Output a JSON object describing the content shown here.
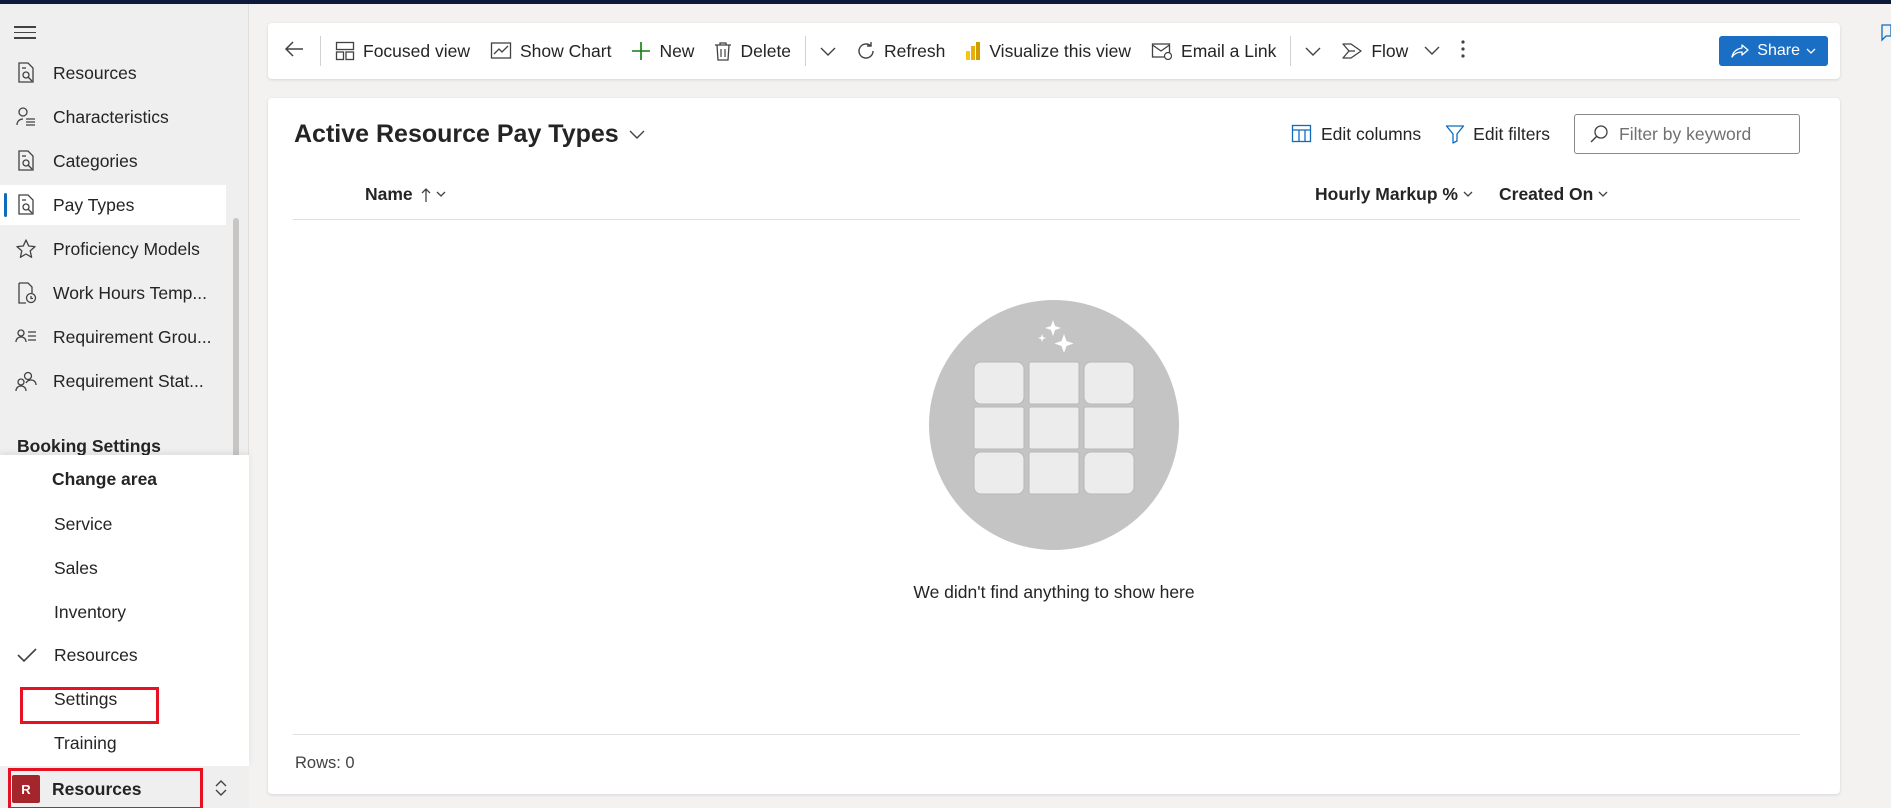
{
  "sidebar": {
    "items": [
      {
        "label": "Resources",
        "icon": "resource-list-icon",
        "active": false
      },
      {
        "label": "Characteristics",
        "icon": "person-characteristics-icon",
        "active": false
      },
      {
        "label": "Categories",
        "icon": "resource-list-icon",
        "active": false
      },
      {
        "label": "Pay Types",
        "icon": "resource-list-icon",
        "active": true
      },
      {
        "label": "Proficiency Models",
        "icon": "star-icon",
        "active": false
      },
      {
        "label": "Work Hours Temp...",
        "icon": "clock-document-icon",
        "active": false
      },
      {
        "label": "Requirement Grou...",
        "icon": "person-list-icon",
        "active": false
      },
      {
        "label": "Requirement Stat...",
        "icon": "people-icon",
        "active": false
      }
    ],
    "section_header": "Booking Settings",
    "area_menu": {
      "title": "Change area",
      "items": [
        {
          "label": "Service",
          "checked": false
        },
        {
          "label": "Sales",
          "checked": false
        },
        {
          "label": "Inventory",
          "checked": false
        },
        {
          "label": "Resources",
          "checked": true
        },
        {
          "label": "Settings",
          "checked": false
        },
        {
          "label": "Training",
          "checked": false
        }
      ]
    },
    "area_switcher": {
      "avatar": "R",
      "label": "Resources"
    }
  },
  "toolbar": {
    "focused_view": "Focused view",
    "show_chart": "Show Chart",
    "new": "New",
    "delete": "Delete",
    "refresh": "Refresh",
    "visualize": "Visualize this view",
    "email_link": "Email a Link",
    "flow": "Flow",
    "share": "Share"
  },
  "view": {
    "title": "Active Resource Pay Types",
    "edit_columns": "Edit columns",
    "edit_filters": "Edit filters",
    "filter_placeholder": "Filter by keyword",
    "columns": [
      {
        "label": "Name",
        "sorted": "ascending"
      },
      {
        "label": "Hourly Markup %"
      },
      {
        "label": "Created On"
      }
    ],
    "empty_message": "We didn't find anything to show here",
    "rows_count": "Rows: 0"
  },
  "colors": {
    "accent": "#0f6cbd",
    "share_button": "#1a6fc4",
    "highlight": "#e81123",
    "avatar": "#a4262c"
  }
}
